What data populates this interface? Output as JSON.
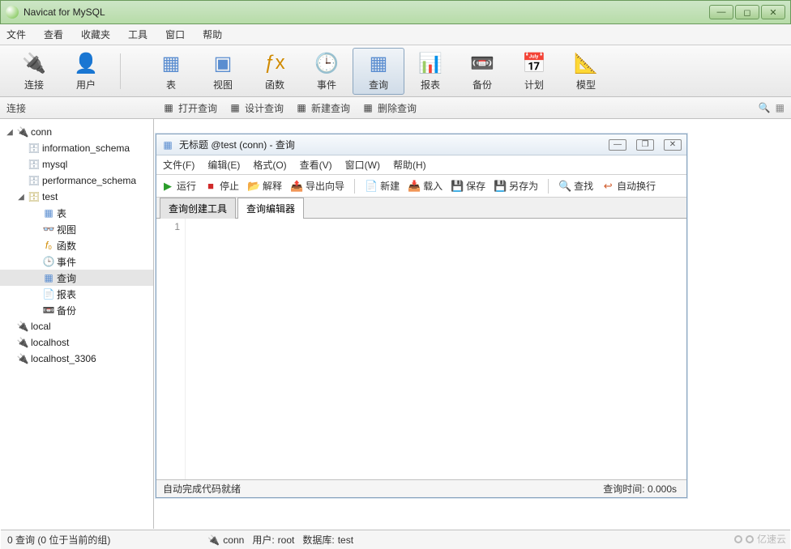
{
  "window": {
    "title": "Navicat for MySQL"
  },
  "menu": {
    "file": "文件",
    "view": "查看",
    "fav": "收藏夹",
    "tool": "工具",
    "window": "窗口",
    "help": "帮助"
  },
  "toolbar": {
    "connect": "连接",
    "user": "用户",
    "table": "表",
    "viewbtn": "视图",
    "func": "函数",
    "event": "事件",
    "query": "查询",
    "report": "报表",
    "backup": "备份",
    "schedule": "计划",
    "model": "模型"
  },
  "subbar": {
    "label": "连接",
    "open": "打开查询",
    "design": "设计查询",
    "newq": "新建查询",
    "del": "删除查询"
  },
  "tree": {
    "conn": "conn",
    "db1": "information_schema",
    "db2": "mysql",
    "db3": "performance_schema",
    "db4": "test",
    "t_table": "表",
    "t_view": "视图",
    "t_func": "函数",
    "t_event": "事件",
    "t_query": "查询",
    "t_report": "报表",
    "t_backup": "备份",
    "c_local": "local",
    "c_localhost": "localhost",
    "c_localhost3306": "localhost_3306"
  },
  "qwin": {
    "title": "无标题 @test (conn) - 查询",
    "menu": {
      "file": "文件(F)",
      "edit": "编辑(E)",
      "format": "格式(O)",
      "view": "查看(V)",
      "window": "窗口(W)",
      "help": "帮助(H)"
    },
    "tool": {
      "run": "运行",
      "stop": "停止",
      "explain": "解释",
      "export": "导出向导",
      "new": "新建",
      "load": "载入",
      "save": "保存",
      "saveas": "另存为",
      "find": "查找",
      "wrap": "自动换行"
    },
    "tabs": {
      "builder": "查询创建工具",
      "editor": "查询编辑器"
    },
    "gutter_line1": "1",
    "status_left": "自动完成代码就绪",
    "status_right": "查询时间: 0.000s"
  },
  "statusbar": {
    "left": "0 查询 (0 位于当前的组)",
    "conn": "conn",
    "user_lbl": "用户:",
    "user_val": "root",
    "db_lbl": "数据库:",
    "db_val": "test"
  },
  "watermark": "亿速云"
}
